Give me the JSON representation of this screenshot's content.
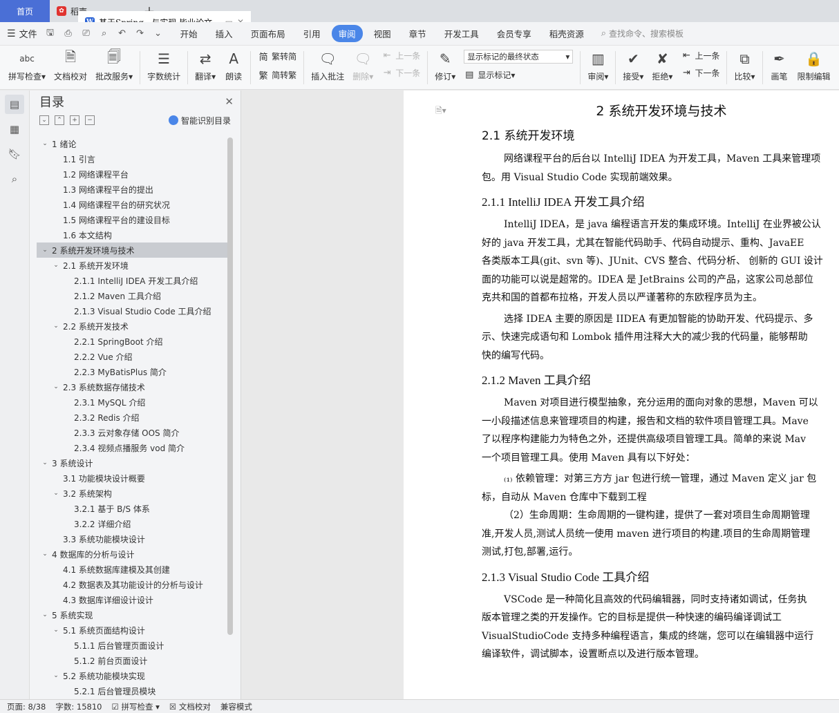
{
  "tabs": {
    "home": "首页",
    "daoke": "稻壳",
    "doc": "基于Spring...与实现 毕业论文",
    "add": "+"
  },
  "menu": {
    "file": "文件",
    "items": [
      "开始",
      "插入",
      "页面布局",
      "引用",
      "审阅",
      "视图",
      "章节",
      "开发工具",
      "会员专享",
      "稻壳资源"
    ],
    "active_index": 4,
    "search": "查找命令、搜索模板"
  },
  "ribbon": {
    "spell": "拼写检查",
    "doc_check": "文档校对",
    "batch": "批改服务",
    "word_count": "字数统计",
    "translate": "翻译",
    "read": "朗读",
    "trad_to_simp": "繁转简",
    "simp_to_trad": "简转繁",
    "insert_comment": "插入批注",
    "delete": "删除",
    "prev": "上一条",
    "next": "下一条",
    "track": "修订",
    "show_markup_select": "显示标记的最终状态",
    "show_markup": "显示标记",
    "review": "审阅",
    "accept": "接受",
    "reject": "拒绝",
    "prev2": "上一条",
    "next2": "下一条",
    "compare": "比较",
    "pen": "画笔",
    "restrict": "限制编辑"
  },
  "toc": {
    "title": "目录",
    "smart": "智能识别目录",
    "items": [
      {
        "level": 0,
        "text": "1  绪论",
        "toggle": "v"
      },
      {
        "level": 1,
        "text": "1.1  引言",
        "toggle": ""
      },
      {
        "level": 1,
        "text": "1.2  网络课程平台",
        "toggle": ""
      },
      {
        "level": 1,
        "text": "1.3  网络课程平台的提出",
        "toggle": ""
      },
      {
        "level": 1,
        "text": "1.4  网络课程平台的研究状况",
        "toggle": ""
      },
      {
        "level": 1,
        "text": "1.5  网络课程平台的建设目标",
        "toggle": ""
      },
      {
        "level": 1,
        "text": "1.6  本文结构",
        "toggle": ""
      },
      {
        "level": 0,
        "text": "2  系统开发环境与技术",
        "toggle": "v",
        "selected": true
      },
      {
        "level": 1,
        "text": "2.1  系统开发环境",
        "toggle": "v"
      },
      {
        "level": 2,
        "text": "2.1.1 IntelliJ IDEA  开发工具介绍",
        "toggle": ""
      },
      {
        "level": 2,
        "text": "2.1.2 Maven 工具介绍",
        "toggle": ""
      },
      {
        "level": 2,
        "text": "2.1.3 Visual Studio Code 工具介绍",
        "toggle": ""
      },
      {
        "level": 1,
        "text": "2.2  系统开发技术",
        "toggle": "v"
      },
      {
        "level": 2,
        "text": "2.2.1 SpringBoot 介绍",
        "toggle": ""
      },
      {
        "level": 2,
        "text": "2.2.2 Vue 介绍",
        "toggle": ""
      },
      {
        "level": 2,
        "text": "2.2.3 MyBatisPlus 简介",
        "toggle": ""
      },
      {
        "level": 1,
        "text": "2.3  系统数据存储技术",
        "toggle": "v"
      },
      {
        "level": 2,
        "text": "2.3.1 MySQL 介绍",
        "toggle": ""
      },
      {
        "level": 2,
        "text": "2.3.2 Redis 介绍",
        "toggle": ""
      },
      {
        "level": 2,
        "text": "2.3.3  云对象存储 OOS 简介",
        "toggle": ""
      },
      {
        "level": 2,
        "text": "2.3.4  视频点播服务 vod 简介",
        "toggle": ""
      },
      {
        "level": 0,
        "text": "3  系统设计",
        "toggle": "v"
      },
      {
        "level": 1,
        "text": "3.1  功能模块设计概要",
        "toggle": ""
      },
      {
        "level": 1,
        "text": "3.2  系统架构",
        "toggle": "v"
      },
      {
        "level": 2,
        "text": "3.2.1  基于 B/S 体系",
        "toggle": ""
      },
      {
        "level": 2,
        "text": "3.2.2  详细介绍",
        "toggle": ""
      },
      {
        "level": 1,
        "text": "3.3  系统功能模块设计",
        "toggle": ""
      },
      {
        "level": 0,
        "text": "4  数据库的分析与设计",
        "toggle": "v"
      },
      {
        "level": 1,
        "text": "4.1  系统数据库建模及其创建",
        "toggle": ""
      },
      {
        "level": 1,
        "text": "4.2  数据表及其功能设计的分析与设计",
        "toggle": ""
      },
      {
        "level": 1,
        "text": "4.3  数据库详细设计设计",
        "toggle": ""
      },
      {
        "level": 0,
        "text": "5  系统实现",
        "toggle": "v"
      },
      {
        "level": 1,
        "text": "5.1  系统页面结构设计",
        "toggle": "v"
      },
      {
        "level": 2,
        "text": "5.1.1  后台管理页面设计",
        "toggle": ""
      },
      {
        "level": 2,
        "text": "5.1.2 前台页面设计",
        "toggle": ""
      },
      {
        "level": 1,
        "text": "5.2  系统功能模块实现",
        "toggle": "v"
      },
      {
        "level": 2,
        "text": "5.2.1  后台管理员模块",
        "toggle": ""
      }
    ]
  },
  "doc": {
    "h1": "2  系统开发环境与技术",
    "s21": "2.1  系统开发环境",
    "p21": [
      "网络课程平台的后台以 IntelliJ IDEA 为开发工具，Maven 工具来管理项",
      "包。用 Visual Studio Code  实现前端效果。"
    ],
    "s211": "2.1.1 IntelliJ IDEA  开发工具介绍",
    "p211a": [
      "IntelliJ IDEA，是 java 编程语言开发的集成环境。IntelliJ 在业界被公认",
      "好的 java 开发工具，尤其在智能代码助手、代码自动提示、重构、JavaEE",
      "各类版本工具(git、svn 等)、JUnit、CVS 整合、代码分析、 创新的 GUI 设计",
      "面的功能可以说是超常的。IDEA 是 JetBrains 公司的产品，这家公司总部位",
      "克共和国的首都布拉格，开发人员以严谨著称的东欧程序员为主。"
    ],
    "p211b": [
      "选择 IDEA 主要的原因是 IIDEA 有更加智能的协助开发、代码提示、多",
      "示、快速完成语句和 Lombok 插件用注释大大的减少我的代码量，能够帮助",
      "快的编写代码。"
    ],
    "s212": "2.1.2 Maven 工具介绍",
    "p212a": [
      "Maven 对项目进行模型抽象，充分运用的面向对象的思想，Maven 可以",
      "一小段描述信息来管理项目的构建，报告和文档的软件项目管理工具。Mave",
      "了以程序构建能力为特色之外，还提供高级项目管理工具。简单的来说 Mav",
      "一个项目管理工具。使用 Maven 具有以下好处："
    ],
    "p212b": [
      "₍₁₎ 依赖管理：对第三方方 jar 包进行统一管理，通过 Maven 定义 jar 包",
      "标，自动从 Maven 仓库中下载到工程"
    ],
    "p212c": [
      "（2）生命周期：生命周期的一键构建，提供了一套对项目生命周期管理",
      "准,开发人员,测试人员统一使用 maven 进行项目的构建.项目的生命周期管理",
      "测试,打包,部署,运行。"
    ],
    "s213": "2.1.3 Visual Studio Code 工具介绍",
    "p213": [
      "VSCode 是一种简化且高效的代码编辑器，同时支持诸如调试，任务执",
      "版本管理之类的开发操作。它的目标是提供一种快速的编码编译调试工",
      "VisualStudioCode 支持多种编程语言，集成的终端，您可以在编辑器中运行",
      "编译软件，调试脚本，设置断点以及进行版本管理。"
    ]
  },
  "status": {
    "page": "页面: 8/38",
    "words": "字数: 15810",
    "spell": "拼写检查",
    "check": "文档校对",
    "compat": "兼容模式"
  }
}
